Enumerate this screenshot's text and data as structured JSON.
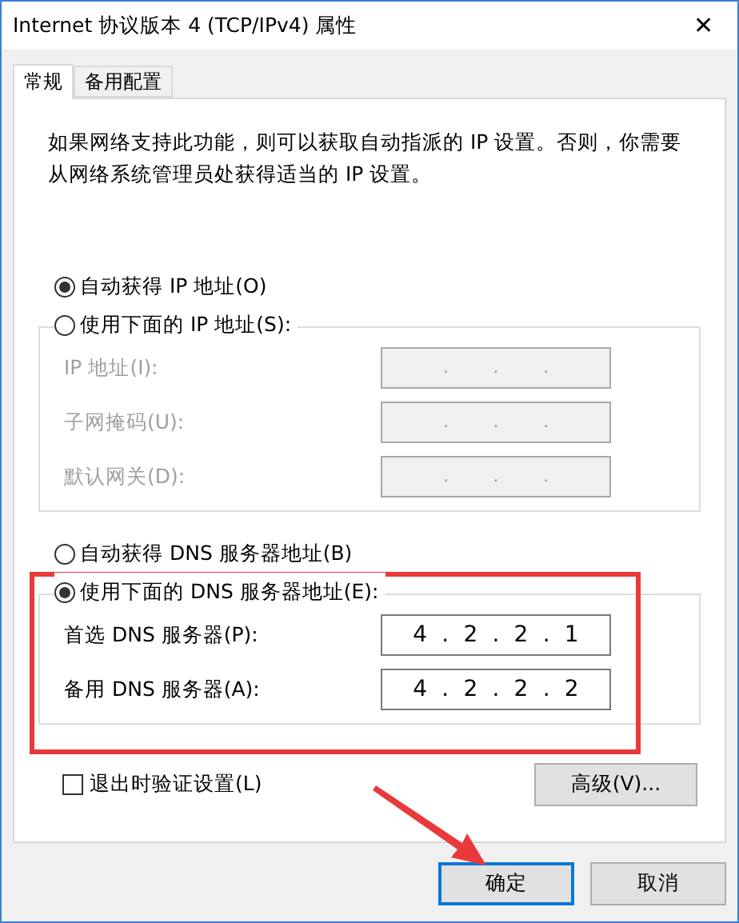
{
  "window": {
    "title": "Internet 协议版本 4 (TCP/IPv4) 属性",
    "close": "✕"
  },
  "tabs": [
    {
      "label": "常规",
      "selected": true
    },
    {
      "label": "备用配置",
      "selected": false
    }
  ],
  "intro": "如果网络支持此功能，则可以获取自动指派的 IP 设置。否则，你需要从网络系统管理员处获得适当的 IP 设置。",
  "sections": [
    {
      "auto_option": {
        "label": "自动获得 IP 地址(O)",
        "selected": true
      },
      "manual_option": {
        "label": "使用下面的 IP 地址(S):",
        "selected": false
      },
      "disabled": true,
      "fields": [
        {
          "label": "IP 地址(I):",
          "value": ". . ."
        },
        {
          "label": "子网掩码(U):",
          "value": ". . ."
        },
        {
          "label": "默认网关(D):",
          "value": ". . ."
        }
      ]
    },
    {
      "auto_option": {
        "label": "自动获得 DNS 服务器地址(B)",
        "selected": false
      },
      "manual_option": {
        "label": "使用下面的 DNS 服务器地址(E):",
        "selected": true
      },
      "disabled": false,
      "fields": [
        {
          "label": "首选 DNS 服务器(P):",
          "value": "4 . 2 . 2 . 1"
        },
        {
          "label": "备用 DNS 服务器(A):",
          "value": "4 . 2 . 2 . 2"
        }
      ]
    }
  ],
  "validate": {
    "label": "退出时验证设置(L)",
    "checked": false
  },
  "advanced_button": "高级(V)...",
  "buttons": [
    {
      "label": "确定",
      "default": true
    },
    {
      "label": "取消",
      "default": false
    }
  ],
  "annotations": {
    "highlight": true,
    "arrow": true
  }
}
